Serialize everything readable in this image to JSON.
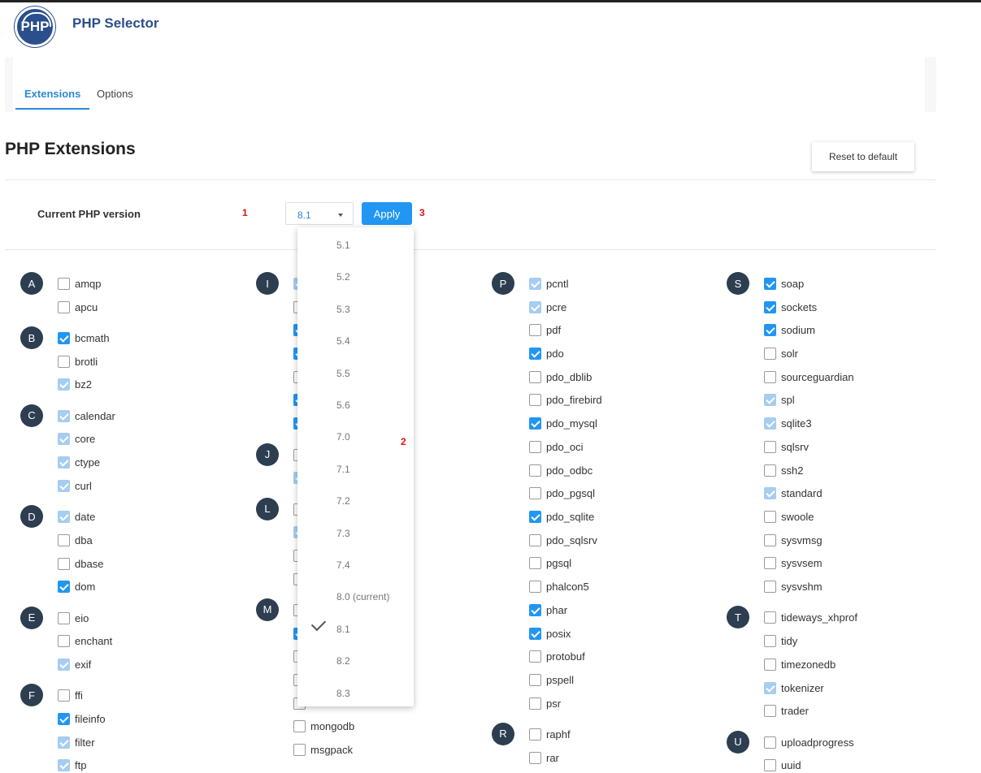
{
  "app": {
    "logo_text": "PHP",
    "title": "PHP Selector"
  },
  "tabs": [
    {
      "label": "Extensions",
      "active": true
    },
    {
      "label": "Options",
      "active": false
    }
  ],
  "page_title": "PHP Extensions",
  "reset_label": "Reset to default",
  "version": {
    "label": "Current PHP version",
    "selected": "8.1",
    "apply_label": "Apply"
  },
  "markers": [
    "1",
    "2",
    "3"
  ],
  "dropdown_options": [
    "5.1",
    "5.2",
    "5.3",
    "5.4",
    "5.5",
    "5.6",
    "7.0",
    "7.1",
    "7.2",
    "7.3",
    "7.4",
    "8.0 (current)",
    "8.1",
    "8.2",
    "8.3"
  ],
  "dropdown_checked": "8.1",
  "colors": {
    "accent": "#2196f3",
    "brand": "#2b4f8c",
    "letter_bg": "#2c3e50",
    "marker": "#dd1111"
  },
  "columns": [
    {
      "groups": [
        {
          "letter": "A",
          "items": [
            {
              "name": "amqp",
              "state": "off"
            },
            {
              "name": "apcu",
              "state": "off"
            }
          ]
        },
        {
          "letter": "B",
          "items": [
            {
              "name": "bcmath",
              "state": "on"
            },
            {
              "name": "brotli",
              "state": "off"
            },
            {
              "name": "bz2",
              "state": "dis"
            }
          ]
        },
        {
          "letter": "C",
          "items": [
            {
              "name": "calendar",
              "state": "dis"
            },
            {
              "name": "core",
              "state": "dis"
            },
            {
              "name": "ctype",
              "state": "dis"
            },
            {
              "name": "curl",
              "state": "dis"
            }
          ]
        },
        {
          "letter": "D",
          "items": [
            {
              "name": "date",
              "state": "dis"
            },
            {
              "name": "dba",
              "state": "off"
            },
            {
              "name": "dbase",
              "state": "off"
            },
            {
              "name": "dom",
              "state": "on"
            }
          ]
        },
        {
          "letter": "E",
          "items": [
            {
              "name": "eio",
              "state": "off"
            },
            {
              "name": "enchant",
              "state": "off"
            },
            {
              "name": "exif",
              "state": "dis"
            }
          ]
        },
        {
          "letter": "F",
          "items": [
            {
              "name": "ffi",
              "state": "off"
            },
            {
              "name": "fileinfo",
              "state": "on"
            },
            {
              "name": "filter",
              "state": "dis"
            },
            {
              "name": "ftp",
              "state": "dis"
            }
          ]
        }
      ]
    },
    {
      "groups": [
        {
          "letter": "I",
          "items": [
            {
              "name": "",
              "state": "dis"
            },
            {
              "name": "",
              "state": "off"
            },
            {
              "name": "",
              "state": "on"
            },
            {
              "name": "",
              "state": "on"
            },
            {
              "name": "",
              "state": "off"
            },
            {
              "name": "",
              "state": "on"
            },
            {
              "name": "",
              "state": "on"
            }
          ]
        },
        {
          "letter": "J",
          "items": [
            {
              "name": "",
              "state": "off"
            },
            {
              "name": "",
              "state": "dis"
            }
          ]
        },
        {
          "letter": "L",
          "items": [
            {
              "name": "",
              "state": "off"
            },
            {
              "name": "",
              "state": "dis"
            },
            {
              "name": "",
              "state": "off"
            },
            {
              "name": "",
              "state": "off"
            }
          ]
        },
        {
          "letter": "M",
          "items": [
            {
              "name": "",
              "state": "off"
            },
            {
              "name": "",
              "state": "on"
            },
            {
              "name": "",
              "state": "off"
            },
            {
              "name": "",
              "state": "off"
            },
            {
              "name": "",
              "state": "off"
            },
            {
              "name": "mongodb",
              "state": "off"
            },
            {
              "name": "msgpack",
              "state": "off"
            }
          ]
        }
      ]
    },
    {
      "groups": [
        {
          "letter": "P",
          "items": [
            {
              "name": "pcntl",
              "state": "dis"
            },
            {
              "name": "pcre",
              "state": "dis"
            },
            {
              "name": "pdf",
              "state": "off"
            },
            {
              "name": "pdo",
              "state": "on"
            },
            {
              "name": "pdo_dblib",
              "state": "off"
            },
            {
              "name": "pdo_firebird",
              "state": "off"
            },
            {
              "name": "pdo_mysql",
              "state": "on"
            },
            {
              "name": "pdo_oci",
              "state": "off"
            },
            {
              "name": "pdo_odbc",
              "state": "off"
            },
            {
              "name": "pdo_pgsql",
              "state": "off"
            },
            {
              "name": "pdo_sqlite",
              "state": "on"
            },
            {
              "name": "pdo_sqlsrv",
              "state": "off"
            },
            {
              "name": "pgsql",
              "state": "off"
            },
            {
              "name": "phalcon5",
              "state": "off"
            },
            {
              "name": "phar",
              "state": "on"
            },
            {
              "name": "posix",
              "state": "on"
            },
            {
              "name": "protobuf",
              "state": "off"
            },
            {
              "name": "pspell",
              "state": "off"
            },
            {
              "name": "psr",
              "state": "off"
            }
          ]
        },
        {
          "letter": "R",
          "items": [
            {
              "name": "raphf",
              "state": "off"
            },
            {
              "name": "rar",
              "state": "off"
            }
          ]
        }
      ]
    },
    {
      "groups": [
        {
          "letter": "S",
          "items": [
            {
              "name": "soap",
              "state": "on"
            },
            {
              "name": "sockets",
              "state": "on"
            },
            {
              "name": "sodium",
              "state": "on"
            },
            {
              "name": "solr",
              "state": "off"
            },
            {
              "name": "sourceguardian",
              "state": "off"
            },
            {
              "name": "spl",
              "state": "dis"
            },
            {
              "name": "sqlite3",
              "state": "dis"
            },
            {
              "name": "sqlsrv",
              "state": "off"
            },
            {
              "name": "ssh2",
              "state": "off"
            },
            {
              "name": "standard",
              "state": "dis"
            },
            {
              "name": "swoole",
              "state": "off"
            },
            {
              "name": "sysvmsg",
              "state": "off"
            },
            {
              "name": "sysvsem",
              "state": "off"
            },
            {
              "name": "sysvshm",
              "state": "off"
            }
          ]
        },
        {
          "letter": "T",
          "items": [
            {
              "name": "tideways_xhprof",
              "state": "off"
            },
            {
              "name": "tidy",
              "state": "off"
            },
            {
              "name": "timezonedb",
              "state": "off"
            },
            {
              "name": "tokenizer",
              "state": "dis"
            },
            {
              "name": "trader",
              "state": "off"
            }
          ]
        },
        {
          "letter": "U",
          "items": [
            {
              "name": "uploadprogress",
              "state": "off"
            },
            {
              "name": "uuid",
              "state": "off"
            }
          ]
        }
      ]
    }
  ]
}
